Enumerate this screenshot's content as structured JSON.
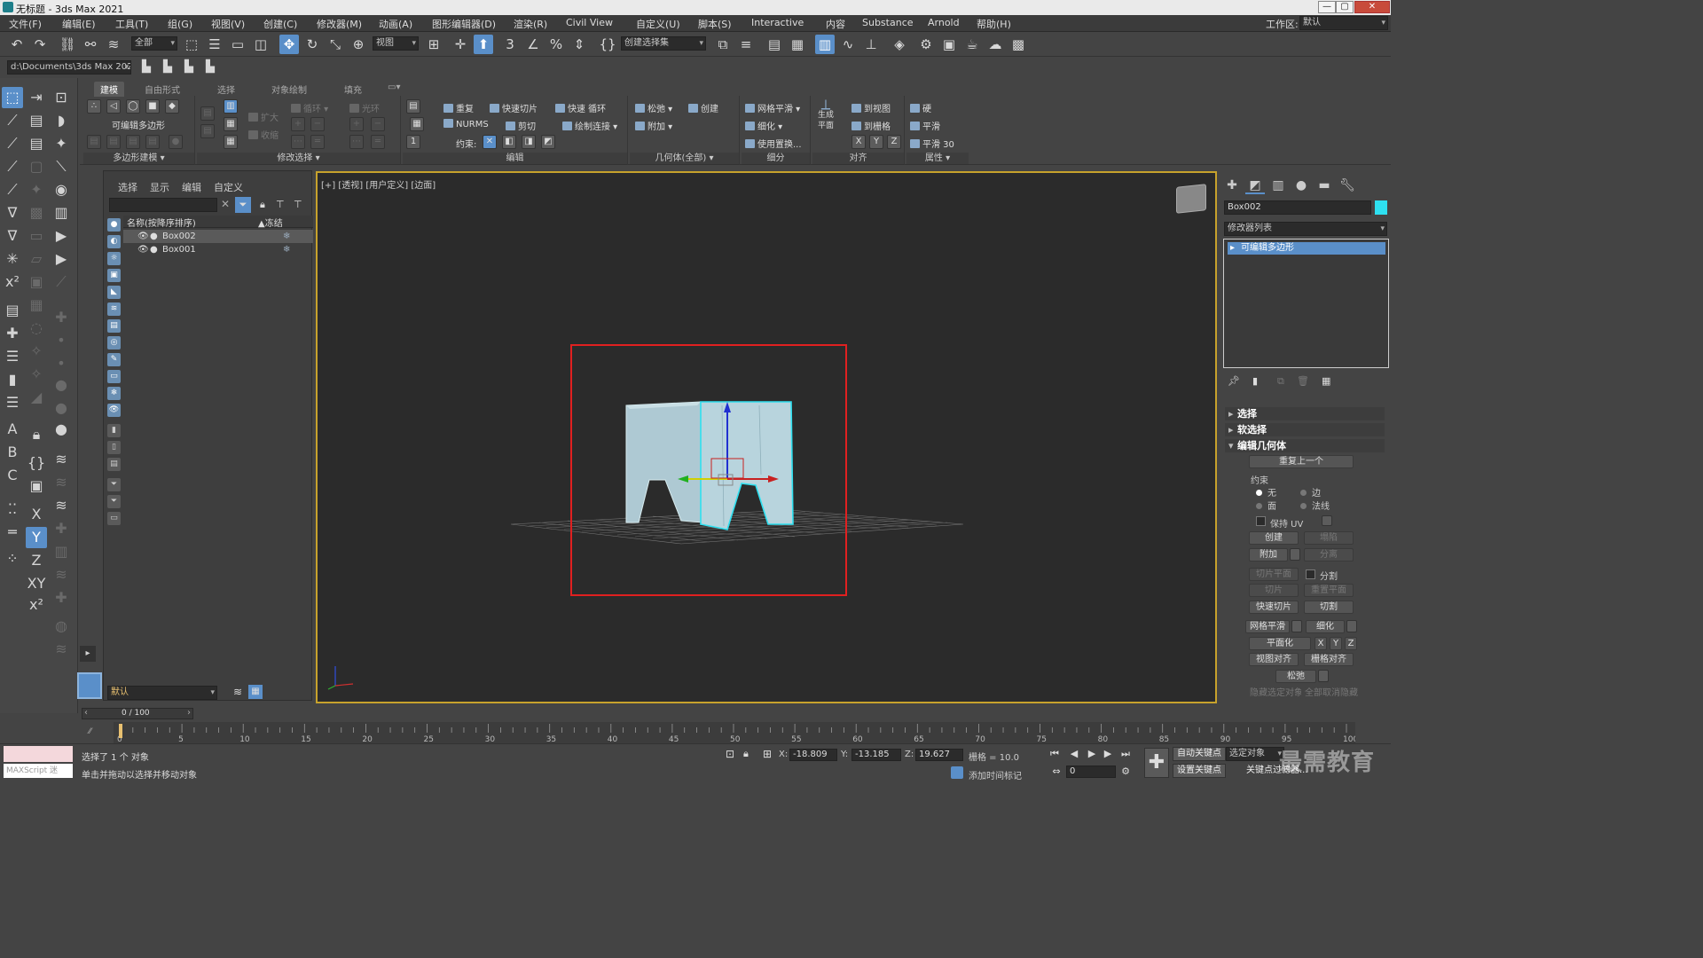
{
  "window": {
    "title": "无标题 - 3ds Max 2021",
    "workspace_label": "工作区:",
    "workspace_value": "默认"
  },
  "menu": [
    "文件(F)",
    "编辑(E)",
    "工具(T)",
    "组(G)",
    "视图(V)",
    "创建(C)",
    "修改器(M)",
    "动画(A)",
    "图形编辑器(D)",
    "渲染(R)",
    "Civil View",
    "自定义(U)",
    "脚本(S)",
    "Interactive",
    "内容",
    "Substance",
    "Arnold",
    "帮助(H)"
  ],
  "toolbar": {
    "filter_select": "全部",
    "refcoord_select": "视图",
    "named_selection": "创建选择集",
    "snap_label": "3",
    "project_path": "d:\\Documents\\3ds Max 2021"
  },
  "ribbon": {
    "tabs": [
      "建模",
      "自由形式",
      "选择",
      "对象绘制",
      "填充"
    ],
    "polygon_modeling": {
      "object_label": "可编辑多边形",
      "title": "多边形建模"
    },
    "modify_selection": {
      "grow": "扩大",
      "shrink": "收缩",
      "loop": "循环",
      "ring": "光环",
      "title": "修改选择"
    },
    "edit": {
      "repeat": "重复",
      "quick_slice": "快速切片",
      "quick_loop": "快速 循环",
      "nurms": "NURMS",
      "cut": "剪切",
      "paint_connect": "绘制连接",
      "constraint_label": "约束:",
      "title": "编辑"
    },
    "geometry": {
      "relax": "松弛",
      "create": "创建",
      "attach": "附加",
      "title": "几何体(全部)"
    },
    "subdivision": {
      "meshsmooth": "网格平滑",
      "tessellate": "细化",
      "use_displace": "使用置换...",
      "title": "细分"
    },
    "align": {
      "make_planar": "生成 平面",
      "to_view": "到视图",
      "to_grid": "到栅格",
      "x": "X",
      "y": "Y",
      "z": "Z",
      "title": "对齐"
    },
    "properties": {
      "hard": "硬",
      "smooth": "平滑",
      "smooth30": "平滑 30",
      "title": "属性"
    }
  },
  "scene_explorer": {
    "tabs": [
      "选择",
      "显示",
      "编辑",
      "自定义"
    ],
    "col_name": "名称(按降序排序)",
    "col_freeze": "▲冻结",
    "rows": [
      {
        "name": "Box002",
        "selected": true
      },
      {
        "name": "Box001",
        "selected": false
      }
    ],
    "layer_value": "默认"
  },
  "viewport": {
    "label": "[+] [透视] [用户定义] [边面]",
    "grid_visible": true,
    "selection_color": "#e02020"
  },
  "command_panel": {
    "object_name": "Box002",
    "modifier_list": "修改器列表",
    "stack_item": "可编辑多边形",
    "rollouts": {
      "selection": "选择",
      "soft_selection": "软选择",
      "edit_geometry": "编辑几何体"
    },
    "edit_geometry": {
      "repeat_last": "重复上一个",
      "constraints_label": "约束",
      "c_none": "无",
      "c_edge": "边",
      "c_face": "面",
      "c_normal": "法线",
      "preserve_uv": "保持 UV",
      "create": "创建",
      "collapse": "塌陷",
      "attach": "附加",
      "detach": "分离",
      "slice_plane": "切片平面",
      "split": "分割",
      "slice": "切片",
      "reset_plane": "重置平面",
      "quickslice": "快速切片",
      "cut": "切割",
      "meshsmooth": "网格平滑",
      "tessellate": "细化",
      "make_planar": "平面化",
      "x": "X",
      "y": "Y",
      "z": "Z",
      "view_align": "视图对齐",
      "grid_align": "栅格对齐",
      "relax": "松弛",
      "hide_selected": "隐藏选定对象",
      "unhide_all": "全部取消隐藏"
    }
  },
  "timeline": {
    "frame": "0 / 100",
    "ticks": [
      "0",
      "5",
      "10",
      "15",
      "20",
      "25",
      "30",
      "35",
      "40",
      "45",
      "50",
      "55",
      "60",
      "65",
      "70",
      "75",
      "80",
      "85",
      "90",
      "95",
      "100"
    ],
    "current_frame": 0,
    "total_frames": 100
  },
  "status": {
    "maxscript": "MAXScript 迷",
    "selected": "选择了 1 个 对象",
    "hint": "单击并拖动以选择并移动对象",
    "x_label": "X:",
    "x": "-18.809",
    "y_label": "Y:",
    "y": "-13.185",
    "z_label": "Z:",
    "z": "19.627",
    "grid": "栅格 = 10.0",
    "add_time_tag": "添加时间标记",
    "auto_key": "自动关键点",
    "selected_obj": "选定对象",
    "set_key": "设置关键点",
    "key_filters": "关键点过滤器...",
    "frame_field": "0",
    "watermark": "最需教育"
  }
}
